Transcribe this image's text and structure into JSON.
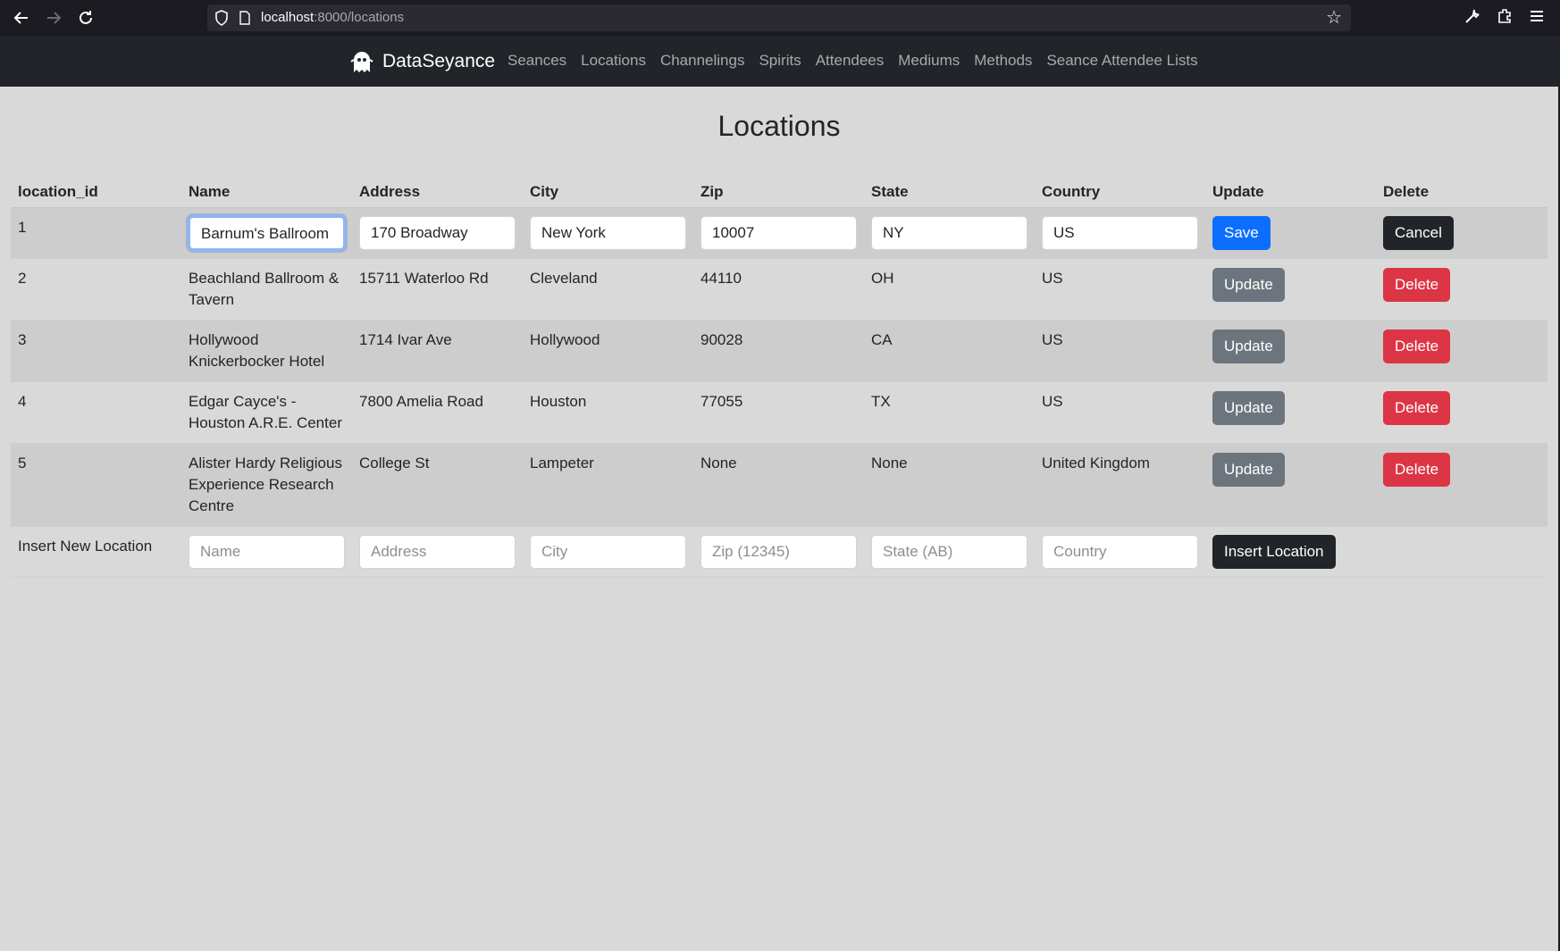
{
  "browser": {
    "url_host": "localhost",
    "url_path": ":8000/locations"
  },
  "nav": {
    "brand": "DataSeyance",
    "links": [
      "Seances",
      "Locations",
      "Channelings",
      "Spirits",
      "Attendees",
      "Mediums",
      "Methods",
      "Seance Attendee Lists"
    ]
  },
  "page": {
    "title": "Locations"
  },
  "table": {
    "headers": [
      "location_id",
      "Name",
      "Address",
      "City",
      "Zip",
      "State",
      "Country",
      "Update",
      "Delete"
    ],
    "edit_row": {
      "id": "1",
      "name": "Barnum's Ballroom",
      "address": "170 Broadway",
      "city": "New York",
      "zip": "10007",
      "state": "NY",
      "country": "US",
      "save_label": "Save",
      "cancel_label": "Cancel"
    },
    "rows": [
      {
        "id": "2",
        "name": "Beachland Ballroom & Tavern",
        "address": "15711 Waterloo Rd",
        "city": "Cleveland",
        "zip": "44110",
        "state": "OH",
        "country": "US"
      },
      {
        "id": "3",
        "name": "Hollywood Knickerbocker Hotel",
        "address": "1714 Ivar Ave",
        "city": "Hollywood",
        "zip": "90028",
        "state": "CA",
        "country": "US"
      },
      {
        "id": "4",
        "name": "Edgar Cayce's - Houston A.R.E. Center",
        "address": "7800 Amelia Road",
        "city": "Houston",
        "zip": "77055",
        "state": "TX",
        "country": "US"
      },
      {
        "id": "5",
        "name": "Alister Hardy Religious Experience Research Centre",
        "address": "College St",
        "city": "Lampeter",
        "zip": "None",
        "state": "None",
        "country": "United Kingdom"
      }
    ],
    "update_label": "Update",
    "delete_label": "Delete",
    "insert_row": {
      "label": "Insert New Location",
      "placeholders": {
        "name": "Name",
        "address": "Address",
        "city": "City",
        "zip": "Zip (12345)",
        "state": "State (AB)",
        "country": "Country"
      },
      "button_label": "Insert Location"
    }
  },
  "colors": {
    "primary": "#0d6efd",
    "danger": "#dc3545",
    "secondary": "#6c757d",
    "dark": "#212529"
  },
  "icons": [
    "back-arrow-icon",
    "forward-arrow-icon",
    "reload-icon",
    "shield-icon",
    "page-icon",
    "bookmark-star-icon",
    "wrench-icon",
    "extensions-icon",
    "menu-icon",
    "ghost-logo-icon"
  ]
}
